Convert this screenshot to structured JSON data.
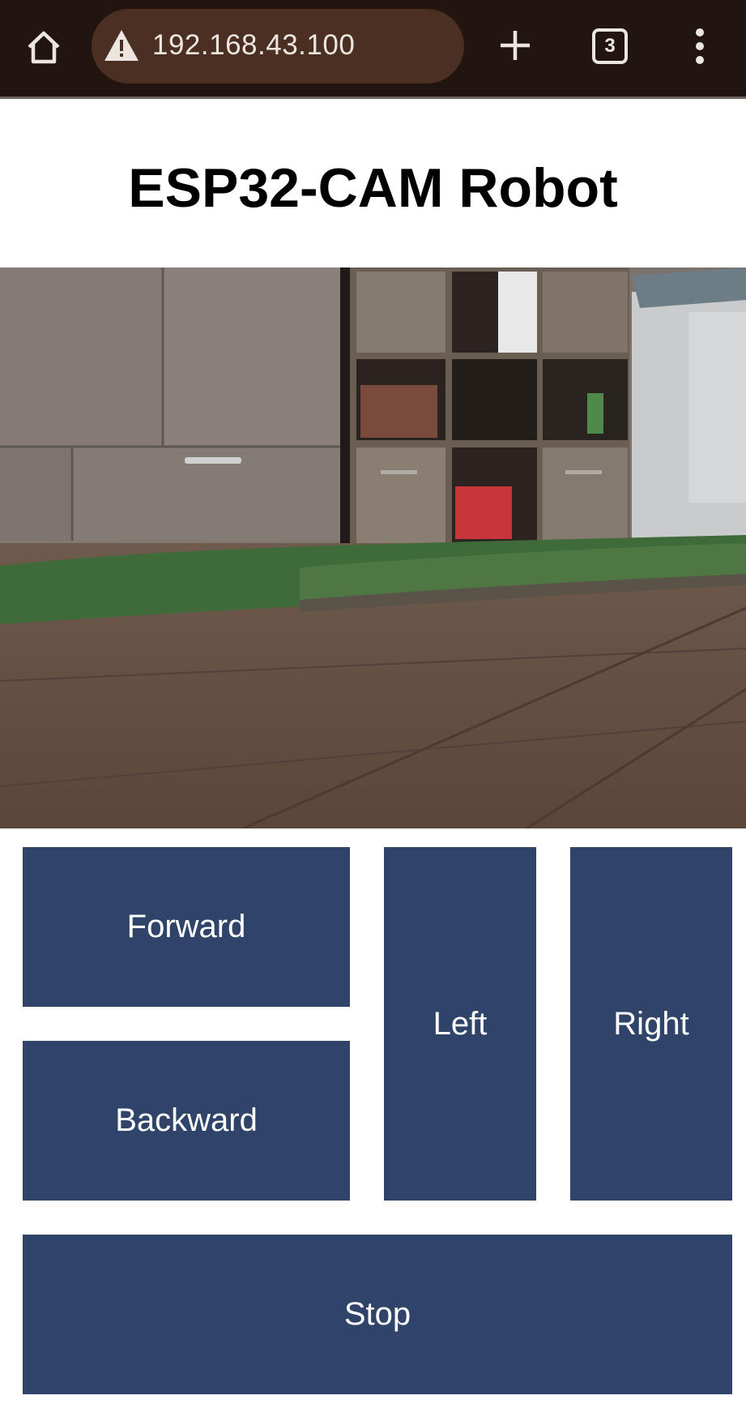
{
  "browser": {
    "url": "192.168.43.100",
    "tab_count": "3",
    "icons": [
      "home-icon",
      "warning-icon",
      "plus-icon",
      "tabs-icon",
      "more-vert-icon"
    ],
    "bar_color": "#22150f",
    "url_box_color": "#4a2f22"
  },
  "page": {
    "title": "ESP32-CAM Robot"
  },
  "camera": {
    "icon": "camera-stream-image"
  },
  "controls": {
    "forward_label": "Forward",
    "backward_label": "Backward",
    "left_label": "Left",
    "right_label": "Right",
    "stop_label": "Stop",
    "button_color": "#30446a"
  }
}
